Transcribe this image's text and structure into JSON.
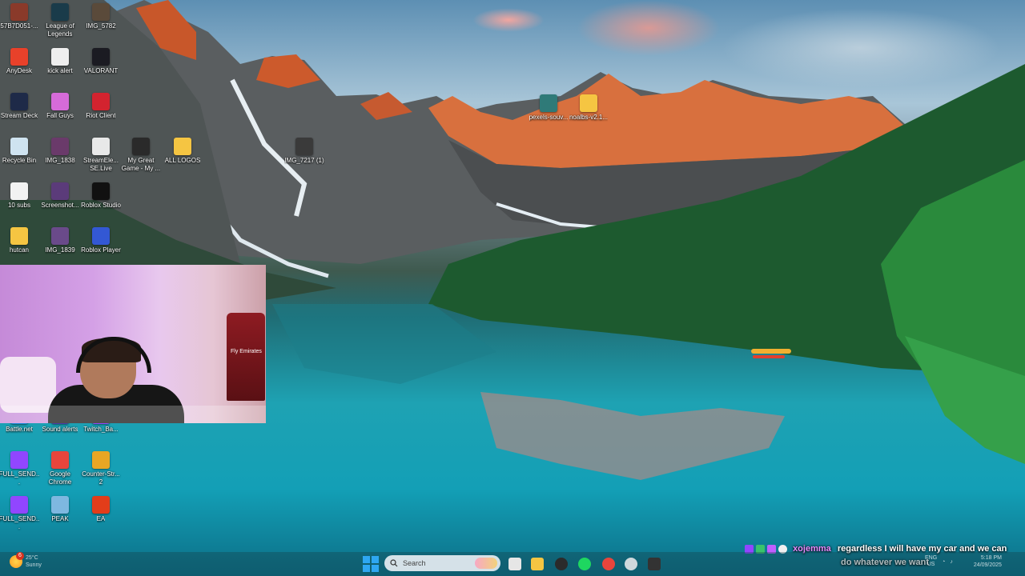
{
  "desktop_icons": [
    {
      "label": "57B7D051-...",
      "icon": "image-icon",
      "color": "#8a3a2a"
    },
    {
      "label": "League of Legends",
      "icon": "league-of-legends-icon",
      "color": "#1a3b4a"
    },
    {
      "label": "IMG_5782",
      "icon": "image-icon",
      "color": "#5a4a3a"
    },
    {
      "label": "AnyDesk",
      "icon": "anydesk-icon",
      "color": "#e8412a"
    },
    {
      "label": "kick alert",
      "icon": "text-file-icon",
      "color": "#eeeeee"
    },
    {
      "label": "VALORANT",
      "icon": "valorant-icon",
      "color": "#1b1b22"
    },
    {
      "label": "Stream Deck",
      "icon": "stream-deck-icon",
      "color": "#1e2a48"
    },
    {
      "label": "Fall Guys",
      "icon": "fall-guys-icon",
      "color": "#d66bd9"
    },
    {
      "label": "Riot Client",
      "icon": "riot-client-icon",
      "color": "#d3232f"
    },
    {
      "label": "Recycle Bin",
      "icon": "recycle-bin-icon",
      "color": "#cfe3f0"
    },
    {
      "label": "IMG_1838",
      "icon": "image-icon",
      "color": "#6a3a6a"
    },
    {
      "label": "StreamEle... SE.Live",
      "icon": "streamelements-icon",
      "color": "#e8e8e8"
    },
    {
      "label": "My Great Game - My ...",
      "icon": "shortcut-icon",
      "color": "#2a2a2a"
    },
    {
      "label": "ALL LOGOS",
      "icon": "folder-icon",
      "color": "#f5c542"
    },
    {
      "label": "10 subs",
      "icon": "text-file-icon",
      "color": "#f2f2f2"
    },
    {
      "label": "Screenshot...",
      "icon": "image-icon",
      "color": "#5b3b7a"
    },
    {
      "label": "Roblox Studio",
      "icon": "roblox-studio-icon",
      "color": "#111111"
    },
    {
      "label": "hutcan",
      "icon": "folder-icon",
      "color": "#f5c542"
    },
    {
      "label": "IMG_1839",
      "icon": "image-icon",
      "color": "#6a4a8a"
    },
    {
      "label": "Roblox Player",
      "icon": "roblox-player-icon",
      "color": "#3358d4"
    },
    {
      "label": "Battle.net",
      "icon": "battlenet-icon",
      "color": "#1a8ad8"
    },
    {
      "label": "Sound alerts",
      "icon": "sound-alerts-icon",
      "color": "#4b3aa8"
    },
    {
      "label": "Twitch_Ba...",
      "icon": "twitch-icon",
      "color": "#9146ff"
    },
    {
      "label": "FULL_SEND...",
      "icon": "twitch-icon",
      "color": "#9146ff"
    },
    {
      "label": "Google Chrome",
      "icon": "chrome-icon",
      "color": "#e8453c"
    },
    {
      "label": "Counter-Str... 2",
      "icon": "counter-strike-icon",
      "color": "#e8a624"
    },
    {
      "label": "FULL_SEND...",
      "icon": "twitch-icon",
      "color": "#9146ff"
    },
    {
      "label": "PEAK",
      "icon": "peak-icon",
      "color": "#7eb8e0"
    },
    {
      "label": "EA",
      "icon": "ea-icon",
      "color": "#e23d1a"
    }
  ],
  "loose_icons": [
    {
      "label": "IMG_7217 (1)",
      "icon": "image-icon",
      "color": "#3a3a3a"
    },
    {
      "label": "pexels-souv...",
      "icon": "image-icon",
      "color": "#2f7a78"
    },
    {
      "label": "noalbs-v2.1...",
      "icon": "folder-icon",
      "color": "#f5c542"
    }
  ],
  "chat": {
    "username": "xojemma",
    "message_line_1": "regardless I will have my car and we can",
    "message_line_2": "do whatever we want"
  },
  "taskbar": {
    "weather_badge": "6",
    "weather_temp": "25°C",
    "weather_desc": "Sunny",
    "search_placeholder": "Search",
    "lang_line_1": "ENG",
    "lang_line_2": "US",
    "clock_time": "5:18 PM",
    "clock_date": "24/09/2025",
    "apps": [
      {
        "name": "task-view-icon",
        "color": "#e6e6e6"
      },
      {
        "name": "file-explorer-icon",
        "color": "#f5c542"
      },
      {
        "name": "obs-icon",
        "color": "#2b2b2b"
      },
      {
        "name": "spotify-icon",
        "color": "#1ed760"
      },
      {
        "name": "chrome-icon",
        "color": "#e8453c"
      },
      {
        "name": "refresh-app-icon",
        "color": "#cfd8dc"
      },
      {
        "name": "terminal-icon",
        "color": "#333333"
      }
    ]
  },
  "webcam": {
    "jersey_text": "Fly Emirates"
  }
}
